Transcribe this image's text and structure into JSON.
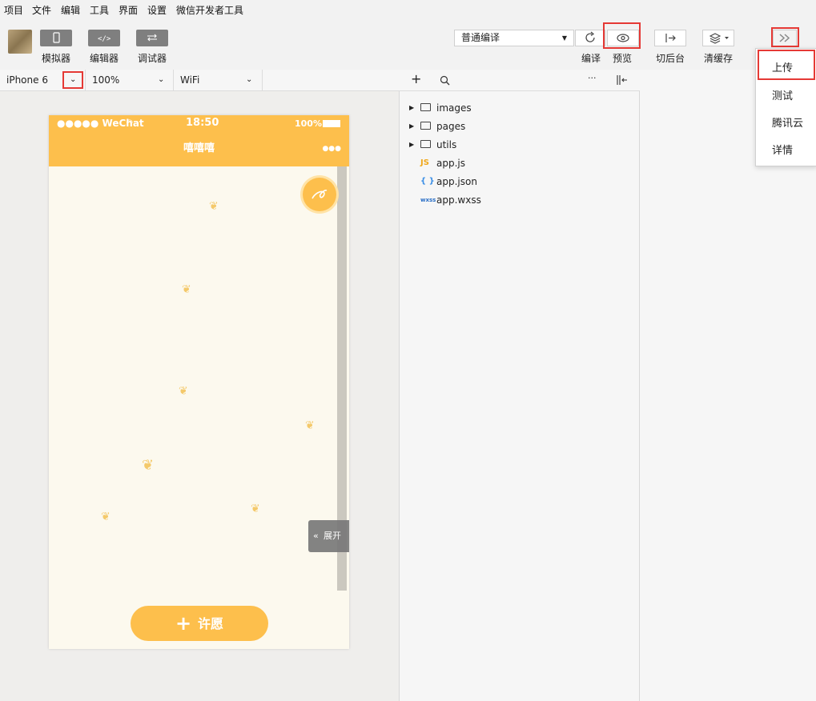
{
  "menubar": {
    "items": [
      "项目",
      "文件",
      "编辑",
      "工具",
      "界面",
      "设置",
      "微信开发者工具"
    ]
  },
  "toolbar": {
    "simulator_label": "模拟器",
    "editor_label": "编辑器",
    "debugger_label": "调试器",
    "compile_mode": "普通编译",
    "compile_label": "编译",
    "preview_label": "预览",
    "background_label": "切后台",
    "clear_cache_label": "清缓存"
  },
  "devicebar": {
    "device": "iPhone 6",
    "zoom": "100%",
    "network": "WiFi"
  },
  "phone": {
    "carrier": "●●●●● WeChat",
    "time": "18:50",
    "battery": "100%",
    "title": "嘻嘻嘻",
    "more": "●●●",
    "expand_label": "展开",
    "wish_label": "许愿"
  },
  "filetree": {
    "folders": [
      "images",
      "pages",
      "utils"
    ],
    "files": [
      {
        "name": "app.js",
        "icon_text": "JS",
        "color": "#f0a81c"
      },
      {
        "name": "app.json",
        "icon_text": "{ }",
        "color": "#3a8ee6"
      },
      {
        "name": "app.wxss",
        "icon_text": "wxss",
        "color": "#2b6fc7"
      }
    ]
  },
  "dropdown": {
    "items": [
      "上传",
      "测试",
      "腾讯云",
      "详情"
    ]
  },
  "colors": {
    "accent": "#fdbf4c",
    "highlight": "#e53935"
  }
}
